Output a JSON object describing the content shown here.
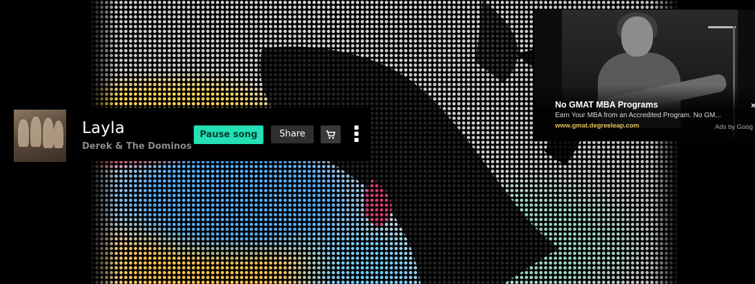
{
  "player": {
    "song_title": "Layla",
    "artist": "Derek & The Dominos",
    "pause_label": "Pause song",
    "share_label": "Share",
    "accent_color": "#24e0b4",
    "cart_icon": "cart-icon",
    "more_icon": "more-vertical-icon"
  },
  "ad": {
    "title": "No GMAT MBA Programs",
    "description": "Earn Your MBA from an Accredited Program. No GM...",
    "url": "www.gmat.degreeleap.com",
    "ads_by": "Ads by Goog",
    "close_glyph": "×"
  }
}
